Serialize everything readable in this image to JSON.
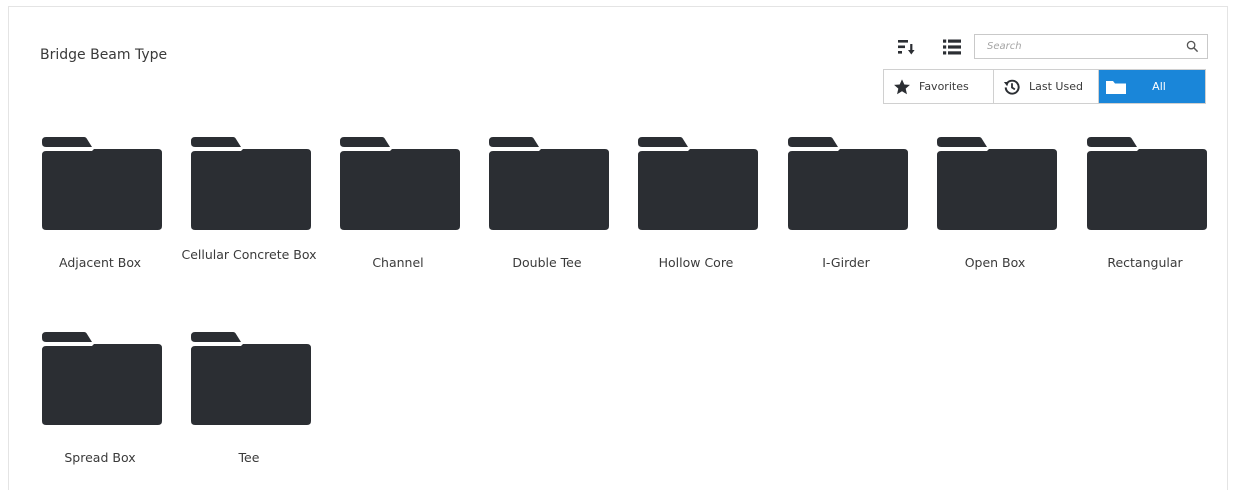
{
  "page": {
    "title": "Bridge Beam Type"
  },
  "toolbar": {
    "sort_icon": "sort-descending-icon",
    "list_view_icon": "list-view-icon",
    "search": {
      "placeholder": "Search",
      "value": "",
      "icon": "search-icon"
    }
  },
  "filters": {
    "favorites": {
      "label": "Favorites",
      "icon": "star-icon"
    },
    "last_used": {
      "label": "Last Used",
      "icon": "history-icon"
    },
    "all": {
      "label": "All",
      "icon": "folder-icon",
      "active": true
    }
  },
  "colors": {
    "folder": "#2b2e33",
    "accent": "#1a86d9",
    "text": "#3a3a3a"
  },
  "items": [
    {
      "label": "Adjacent Box",
      "icon": "folder-icon"
    },
    {
      "label": "Cellular Concrete Box",
      "icon": "folder-icon"
    },
    {
      "label": "Channel",
      "icon": "folder-icon"
    },
    {
      "label": "Double Tee",
      "icon": "folder-icon"
    },
    {
      "label": "Hollow Core",
      "icon": "folder-icon"
    },
    {
      "label": "I-Girder",
      "icon": "folder-icon"
    },
    {
      "label": "Open Box",
      "icon": "folder-icon"
    },
    {
      "label": "Rectangular",
      "icon": "folder-icon"
    },
    {
      "label": "Spread Box",
      "icon": "folder-icon"
    },
    {
      "label": "Tee",
      "icon": "folder-icon"
    }
  ]
}
